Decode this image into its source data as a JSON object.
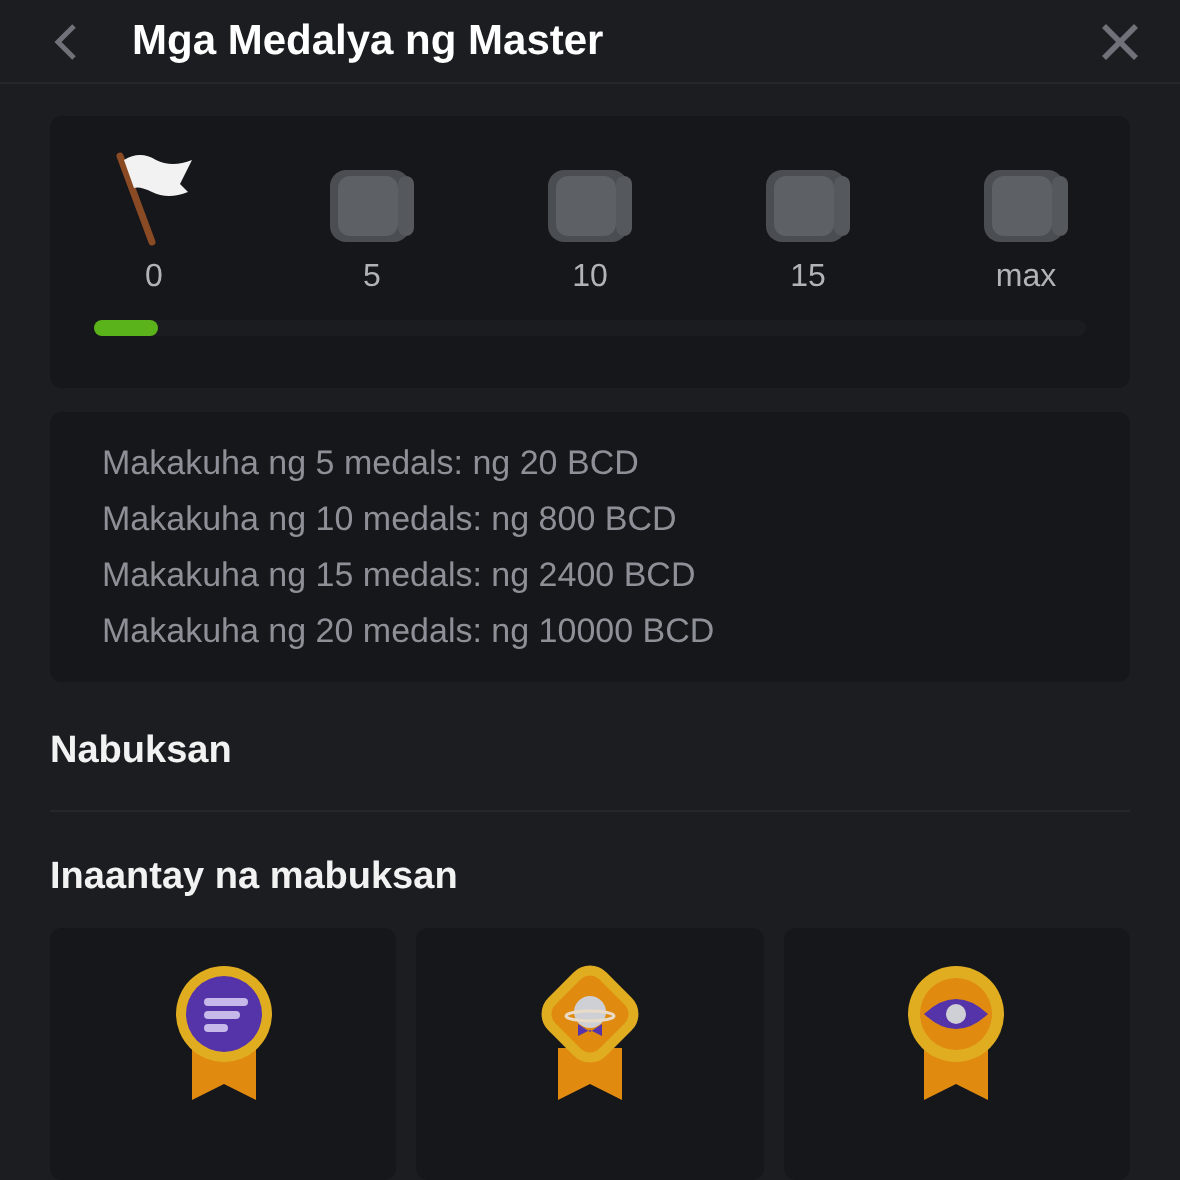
{
  "header": {
    "title": "Mga Medalya ng Master"
  },
  "progress": {
    "milestones": [
      {
        "label": "0",
        "kind": "flag"
      },
      {
        "label": "5",
        "kind": "badge"
      },
      {
        "label": "10",
        "kind": "badge"
      },
      {
        "label": "15",
        "kind": "badge"
      },
      {
        "label": "max",
        "kind": "badge"
      }
    ],
    "level": 0.065
  },
  "rewards": [
    "Makakuha ng 5 medals: ng 20 BCD",
    "Makakuha ng 10 medals: ng 800 BCD",
    "Makakuha ng 15 medals: ng 2400 BCD",
    "Makakuha ng 20 medals: ng 10000 BCD"
  ],
  "unlocked": {
    "title": "Nabuksan"
  },
  "pending": {
    "title": "Inaantay na mabuksan",
    "medals": [
      {
        "kind": "lines"
      },
      {
        "kind": "planet"
      },
      {
        "kind": "eye"
      }
    ]
  }
}
